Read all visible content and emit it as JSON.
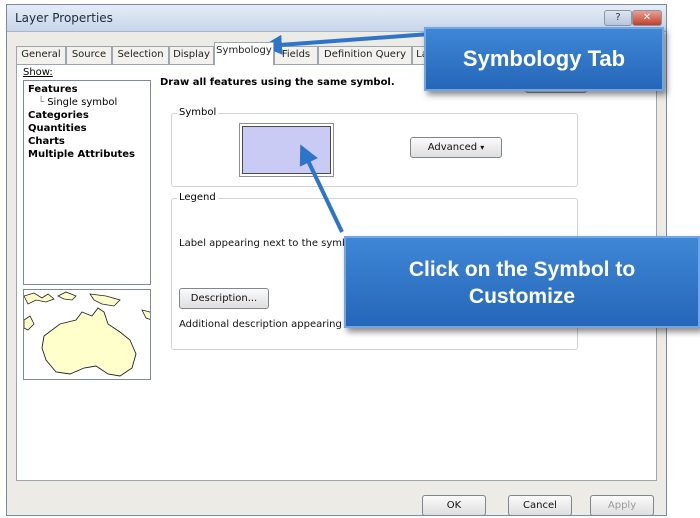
{
  "window": {
    "title": "Layer Properties",
    "help_label": "?",
    "close_label": "✕"
  },
  "tabs": [
    {
      "label": "General"
    },
    {
      "label": "Source"
    },
    {
      "label": "Selection"
    },
    {
      "label": "Display"
    },
    {
      "label": "Symbology",
      "active": true
    },
    {
      "label": "Fields"
    },
    {
      "label": "Definition Query"
    },
    {
      "label": "La"
    }
  ],
  "show": {
    "label": "Show:",
    "items": [
      {
        "label": "Features",
        "bold": true
      },
      {
        "label": "Single symbol",
        "bold": false
      },
      {
        "label": "Categories",
        "bold": true
      },
      {
        "label": "Quantities",
        "bold": true
      },
      {
        "label": "Charts",
        "bold": true
      },
      {
        "label": "Multiple Attributes",
        "bold": true
      }
    ]
  },
  "main": {
    "heading": "Draw all features using the same symbol.",
    "symbol_group": {
      "title": "Symbol",
      "advanced_label": "Advanced",
      "swatch_color": "#c9cbf5"
    },
    "legend_group": {
      "title": "Legend",
      "label_text": "Label appearing next to the symbol in tab",
      "description_button": "Description...",
      "description_text": "Additional description appearing next to b"
    }
  },
  "footer": {
    "ok_label": "OK",
    "cancel_label": "Cancel",
    "apply_label": "Apply"
  },
  "callouts": {
    "symbology_tab": "Symbology Tab",
    "click_symbol": "Click on the Symbol to Customize",
    "color": "#2e74c8"
  }
}
